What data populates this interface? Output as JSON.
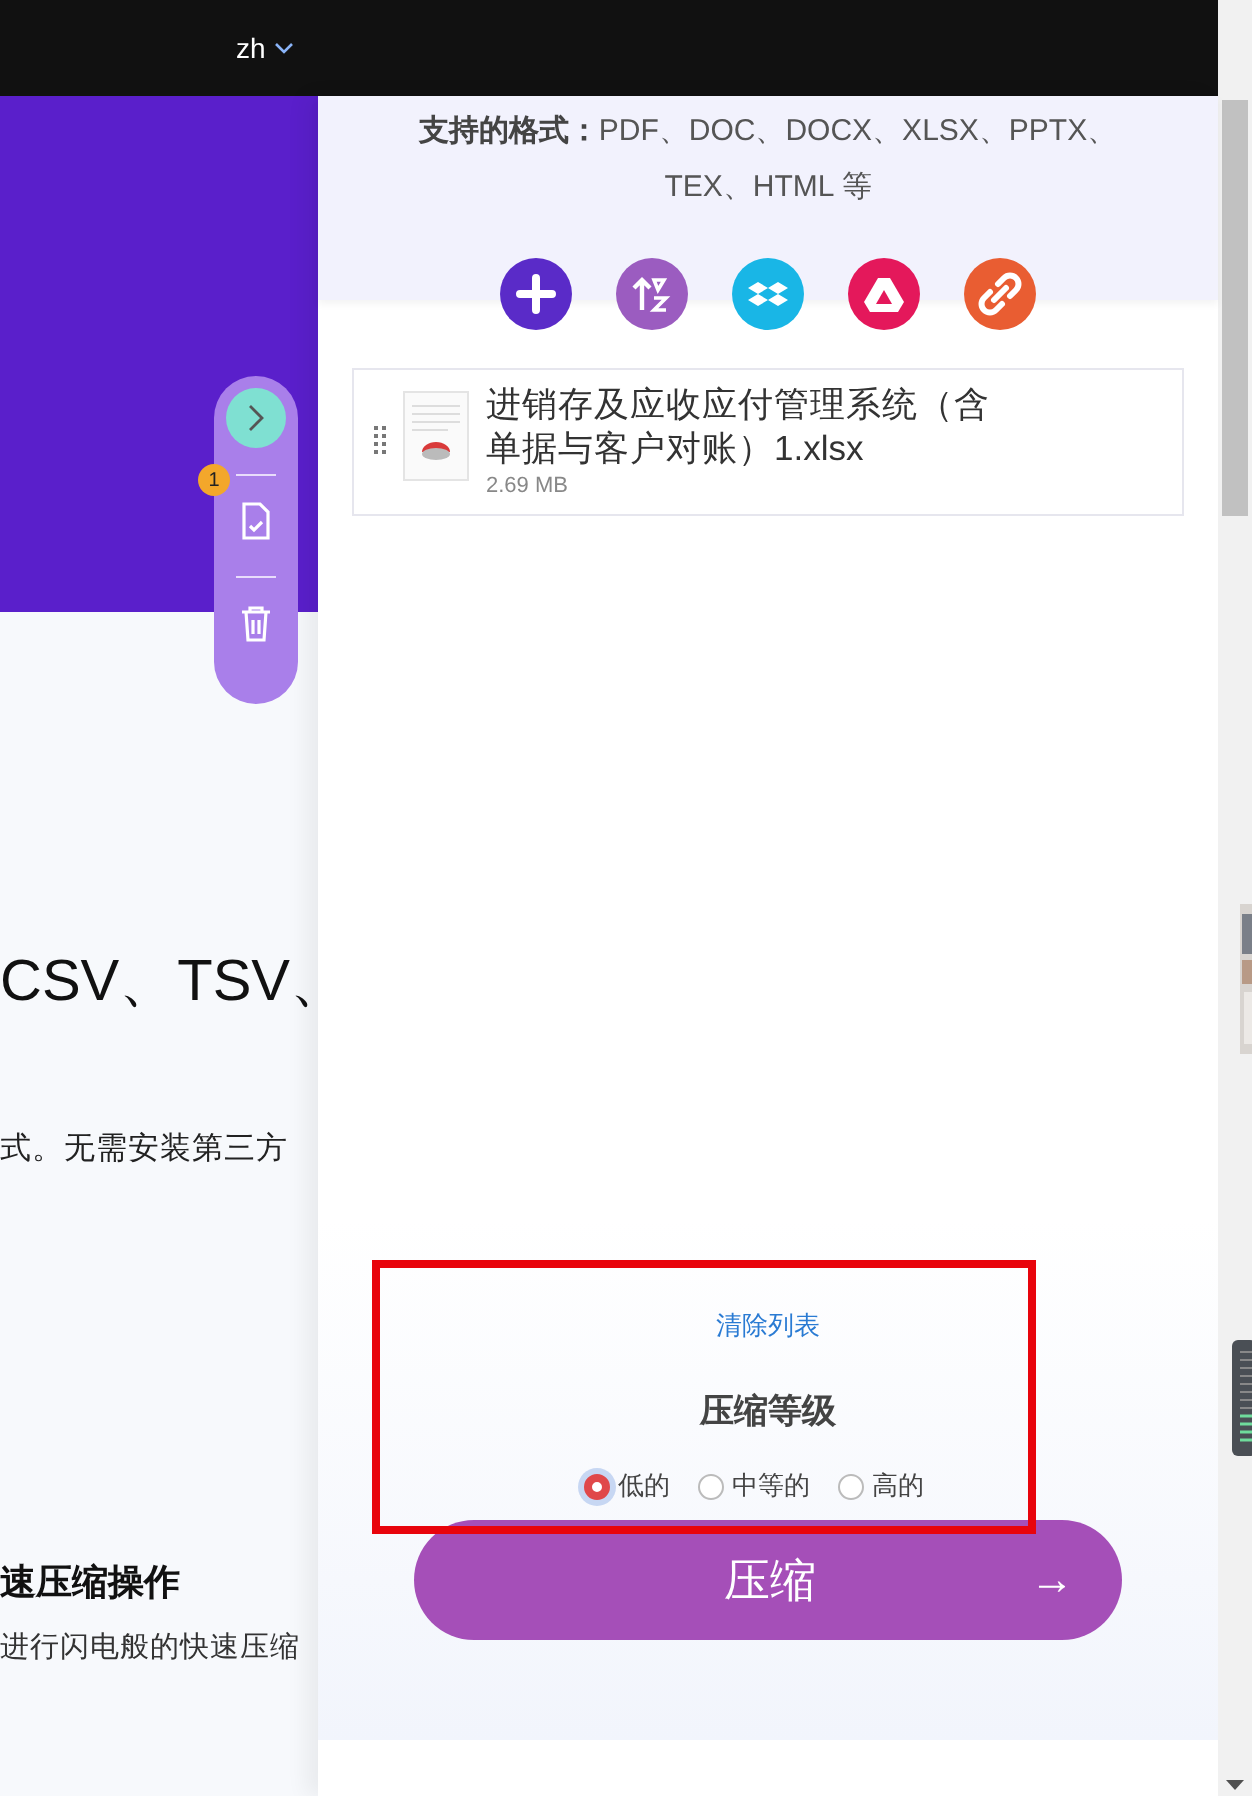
{
  "top_bar": {
    "language": "zh"
  },
  "page": {
    "headline": "CSV、TSV、",
    "paragraph": "式。无需安装第三方",
    "feature_title": "速压缩操作",
    "feature_text": "进行闪电般的快速压缩"
  },
  "toolbar": {
    "badge": "1"
  },
  "upload_panel": {
    "formats": "**支持的格式：**PDF、DOC、DOCX、XLSX、PPTX、TEX、HTML 等",
    "sources": [
      {
        "kind": "add",
        "color": "#5a2bc8"
      },
      {
        "kind": "sort",
        "color": "#9b5cc0"
      },
      {
        "kind": "dropbox",
        "color": "#19b6e6"
      },
      {
        "kind": "drive",
        "color": "#e4185b"
      },
      {
        "kind": "link",
        "color": "#e95d32"
      }
    ],
    "files": [
      {
        "name": "进销存及应收应付管理系统（含单据与客户对账）1.xlsx",
        "size": "2.69 MB"
      }
    ],
    "clear_list": "清除列表",
    "compression": {
      "title": "压缩等级",
      "levels": [
        {
          "label": "低的",
          "selected": true
        },
        {
          "label": "中等的",
          "selected": false
        },
        {
          "label": "高的",
          "selected": false
        }
      ]
    },
    "compress_button": {
      "label": "压缩",
      "arrow": "→"
    }
  }
}
